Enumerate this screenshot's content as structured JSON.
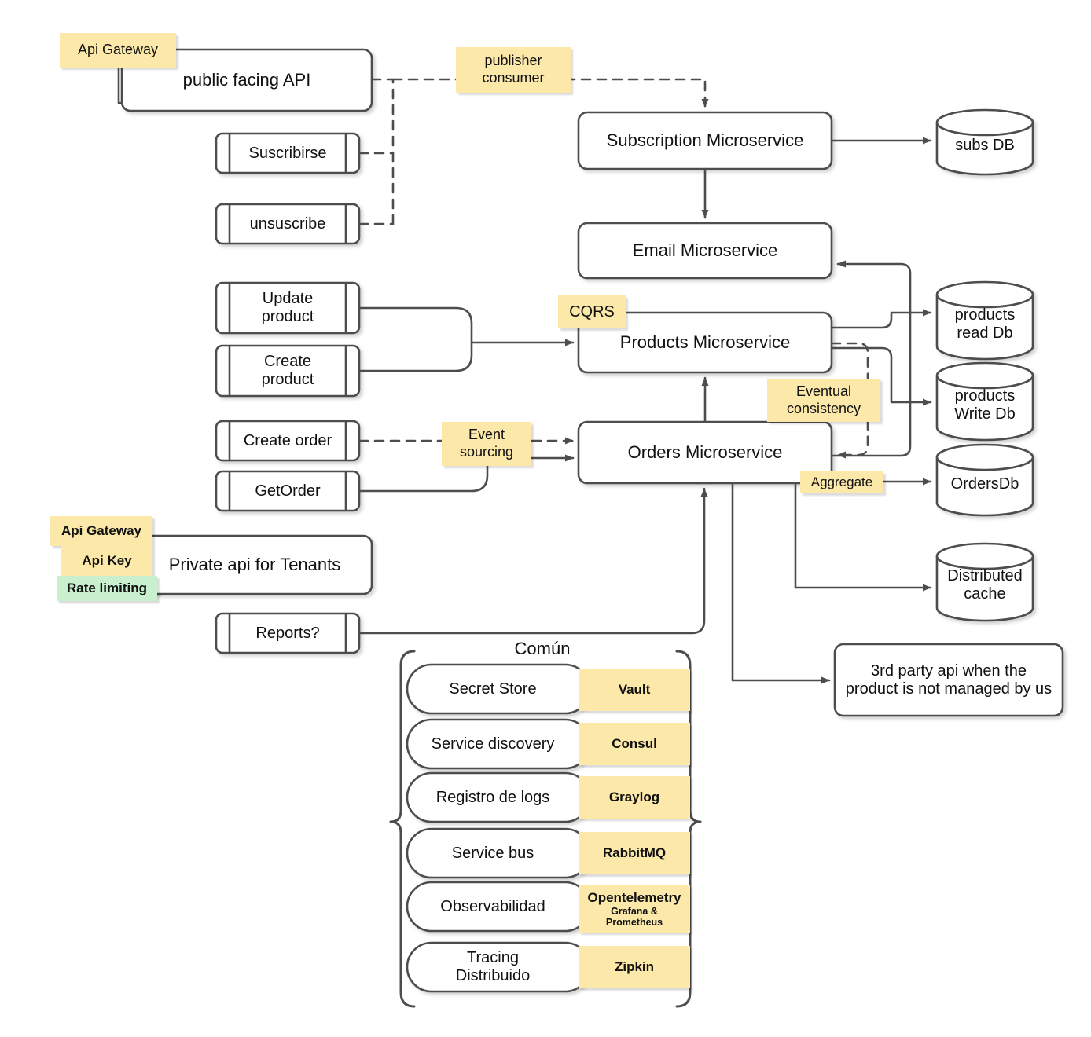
{
  "colors": {
    "stroke": "#4d4d4d",
    "note_yellow": "#FCE8A8",
    "note_green": "#C8F0CF",
    "text": "#111111",
    "background": "#ffffff"
  },
  "notes": {
    "api_gateway_public": "Api Gateway",
    "publisher_consumer": "publisher\nconsumer",
    "cqrs": "CQRS",
    "eventual_consistency": "Eventual\nconsistency",
    "event_sourcing": "Event\nsourcing",
    "aggregate": "Aggregate",
    "api_gateway_private": "Api Gateway",
    "api_key": "Api Key",
    "rate_limiting": "Rate limiting"
  },
  "apis": {
    "public": "public facing API",
    "private": "Private api for Tenants"
  },
  "operations": [
    {
      "label": "Suscribirse"
    },
    {
      "label": "unsuscribe"
    },
    {
      "label": "Update\nproduct"
    },
    {
      "label": "Create\nproduct"
    },
    {
      "label": "Create order"
    },
    {
      "label": "GetOrder"
    },
    {
      "label": "Reports?"
    }
  ],
  "services": [
    {
      "label": "Subscription Microservice"
    },
    {
      "label": "Email Microservice"
    },
    {
      "label": "Products Microservice"
    },
    {
      "label": "Orders Microservice"
    }
  ],
  "databases": [
    {
      "label": "subs DB"
    },
    {
      "label": "products\nread Db"
    },
    {
      "label": "products\nWrite Db"
    },
    {
      "label": "OrdersDb"
    },
    {
      "label": "Distributed\ncache"
    }
  ],
  "external": {
    "third_party": "3rd party api when the product is not managed by us"
  },
  "common": {
    "title": "Común",
    "rows": [
      {
        "concern": "Secret Store",
        "tool": "Vault",
        "tool_sub": ""
      },
      {
        "concern": "Service discovery",
        "tool": "Consul",
        "tool_sub": ""
      },
      {
        "concern": "Registro de logs",
        "tool": "Graylog",
        "tool_sub": ""
      },
      {
        "concern": "Service bus",
        "tool": "RabbitMQ",
        "tool_sub": ""
      },
      {
        "concern": "Observabilidad",
        "tool": "Opentelemetry",
        "tool_sub": "Grafana &\nPrometheus"
      },
      {
        "concern": "Tracing\nDistribuido",
        "tool": "Zipkin",
        "tool_sub": ""
      }
    ]
  }
}
